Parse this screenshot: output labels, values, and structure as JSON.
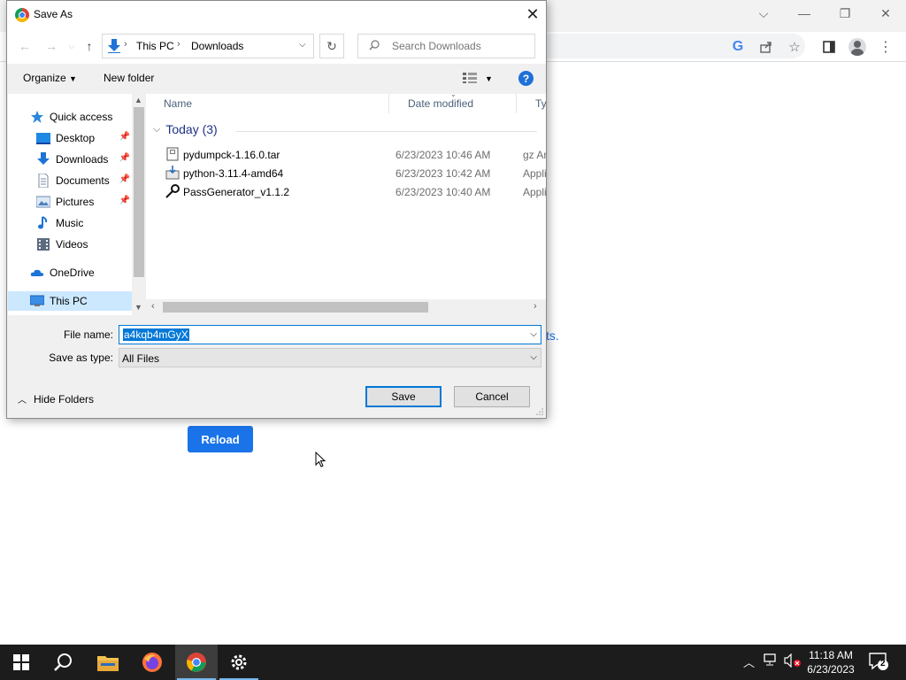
{
  "dialog": {
    "title": "Save As",
    "breadcrumb": [
      "This PC",
      "Downloads"
    ],
    "search_placeholder": "Search Downloads",
    "organize_label": "Organize",
    "new_folder_label": "New folder",
    "help_label": "?",
    "nav_pane": {
      "items": [
        {
          "label": "Quick access",
          "icon": "star-icon"
        },
        {
          "label": "Desktop",
          "icon": "desktop-icon",
          "pinned": true
        },
        {
          "label": "Downloads",
          "icon": "download-arrow-icon",
          "pinned": true
        },
        {
          "label": "Documents",
          "icon": "document-icon",
          "pinned": true
        },
        {
          "label": "Pictures",
          "icon": "pictures-icon",
          "pinned": true
        },
        {
          "label": "Music",
          "icon": "music-note-icon"
        },
        {
          "label": "Videos",
          "icon": "film-icon"
        },
        {
          "label": "OneDrive",
          "icon": "cloud-icon"
        },
        {
          "label": "This PC",
          "icon": "computer-icon",
          "selected": true
        }
      ]
    },
    "columns": [
      "Name",
      "Date modified",
      "Type"
    ],
    "group": "Today (3)",
    "files": [
      {
        "name": "pydumpck-1.16.0.tar",
        "date": "6/23/2023 10:46 AM",
        "type": "gz Ar",
        "icon": "archive-icon"
      },
      {
        "name": "python-3.11.4-amd64",
        "date": "6/23/2023 10:42 AM",
        "type": "Appli",
        "icon": "installer-icon"
      },
      {
        "name": "PassGenerator_v1.1.2",
        "date": "6/23/2023 10:40 AM",
        "type": "Appli",
        "icon": "key-icon"
      }
    ],
    "file_name_label": "File name:",
    "file_name_value": "a4kqb4mGyX",
    "save_type_label": "Save as type:",
    "save_type_value": "All Files",
    "hide_folders_label": "Hide Folders",
    "save_label": "Save",
    "cancel_label": "Cancel"
  },
  "page": {
    "reload_label": "Reload",
    "link_fragment": "ts."
  },
  "taskbar": {
    "time": "11:18 AM",
    "date": "6/23/2023",
    "notification_count": "2",
    "apps": [
      "start-icon",
      "search-icon",
      "file-explorer-icon",
      "firefox-icon",
      "chrome-icon",
      "settings-gear-icon"
    ]
  },
  "colors": {
    "accent": "#0078d7",
    "reload_button": "#1a73e8",
    "taskbar": "#1c1c1c"
  }
}
